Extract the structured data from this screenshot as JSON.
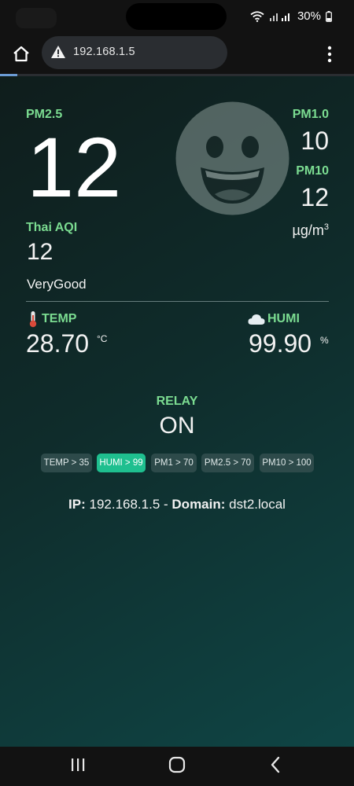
{
  "status_bar": {
    "battery": "30%"
  },
  "browser": {
    "url": "192.168.1.5",
    "load_progress": 0.05
  },
  "air": {
    "pm25_label": "PM2.5",
    "pm25_value": "12",
    "pm10_label": "PM1.0",
    "pm10_value": "10",
    "pm10b_label": "PM10",
    "pm10b_value": "12",
    "unit": "µg/m",
    "unit_sup": "3",
    "aqi_label": "Thai AQI",
    "aqi_value": "12",
    "aqi_status": "VeryGood"
  },
  "climate": {
    "temp_label": "TEMP",
    "temp_value": "28.70",
    "temp_unit": "°C",
    "humi_label": "HUMI",
    "humi_value": "99.90",
    "humi_unit": "%"
  },
  "relay": {
    "label": "RELAY",
    "value": "ON",
    "chips": [
      {
        "label": "TEMP > 35",
        "active": false
      },
      {
        "label": "HUMI > 99",
        "active": true
      },
      {
        "label": "PM1 > 70",
        "active": false
      },
      {
        "label": "PM2.5 > 70",
        "active": false
      },
      {
        "label": "PM10 > 100",
        "active": false
      }
    ]
  },
  "footer": {
    "ip_label": "IP:",
    "ip_value": "192.168.1.5",
    "sep": " - ",
    "domain_label": "Domain:",
    "domain_value": "dst2.local"
  },
  "icons": [
    "wifi-icon",
    "signal-icon",
    "battery-icon",
    "home-icon",
    "warning-icon",
    "more-vert-icon",
    "smiley-icon",
    "thermometer-icon",
    "cloud-icon",
    "recents-icon",
    "home-nav-icon",
    "back-icon"
  ],
  "colors": {
    "accent": "#7bdc91",
    "chip_active": "#1fbf8f",
    "chip": "#2d4a4a",
    "bg_start": "#0f1d1c",
    "bg_end": "#0f4545"
  }
}
